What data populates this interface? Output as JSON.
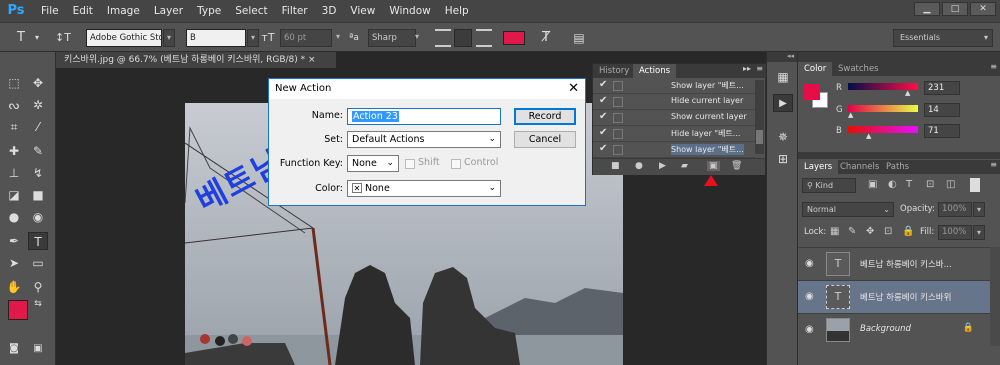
{
  "app": {
    "logo": "Ps"
  },
  "menu": [
    "File",
    "Edit",
    "Image",
    "Layer",
    "Type",
    "Select",
    "Filter",
    "3D",
    "View",
    "Window",
    "Help"
  ],
  "window_controls": {
    "minimize": "▁",
    "maximize": "□",
    "close": "✕"
  },
  "options_bar": {
    "tool_icon": "T",
    "font_family": "Adobe Gothic Std",
    "font_style": "B",
    "font_size": "60 pt",
    "aa_label": "ªa",
    "antialias": "Sharp",
    "text_color": "#e0194a",
    "workspace": "Essentials"
  },
  "document_tab": {
    "title": "키스바위.jpg @ 66.7% (베트남 하롱베이 키스바위, RGB/8) *",
    "close": "×"
  },
  "canvas": {
    "overlay_text": "베트남 하롱베이 키스바위"
  },
  "toolbar": {
    "foreground_color": "#e0194a",
    "background_color": "#ffffff"
  },
  "actions_panel": {
    "tabs": [
      "History",
      "Actions"
    ],
    "active_tab": "Actions",
    "rows": [
      {
        "label": "Show layer \"베트...",
        "checked": true
      },
      {
        "label": "Hide current layer",
        "checked": true
      },
      {
        "label": "Show current layer",
        "checked": true
      },
      {
        "label": "Hide layer \"베트...",
        "checked": true
      },
      {
        "label": "Show layer \"베트...",
        "checked": true
      }
    ]
  },
  "dialog": {
    "title": "New Action",
    "name_label": "Name:",
    "name_value": "Action 23",
    "set_label": "Set:",
    "set_value": "Default Actions",
    "fkey_label": "Function Key:",
    "fkey_value": "None",
    "shift_label": "Shift",
    "control_label": "Control",
    "color_label": "Color:",
    "color_value": "None",
    "record_button": "Record",
    "cancel_button": "Cancel"
  },
  "color_panel": {
    "tabs": [
      "Color",
      "Swatches"
    ],
    "r_label": "R",
    "r_value": "231",
    "g_label": "G",
    "g_value": "14",
    "b_label": "B",
    "b_value": "71",
    "swatch": "#e70e47"
  },
  "layers_panel": {
    "tabs": [
      "Layers",
      "Channels",
      "Paths"
    ],
    "kind": "Kind",
    "blend_mode": "Normal",
    "opacity_label": "Opacity:",
    "opacity_value": "100%",
    "lock_label": "Lock:",
    "fill_label": "Fill:",
    "fill_value": "100%",
    "layers": [
      {
        "name": "베트남 하롱베이 키스바...",
        "type": "text"
      },
      {
        "name": "베트남 하롱베이 키스바위",
        "type": "text",
        "selected": true
      },
      {
        "name": "Background",
        "type": "image",
        "locked": true
      }
    ]
  }
}
